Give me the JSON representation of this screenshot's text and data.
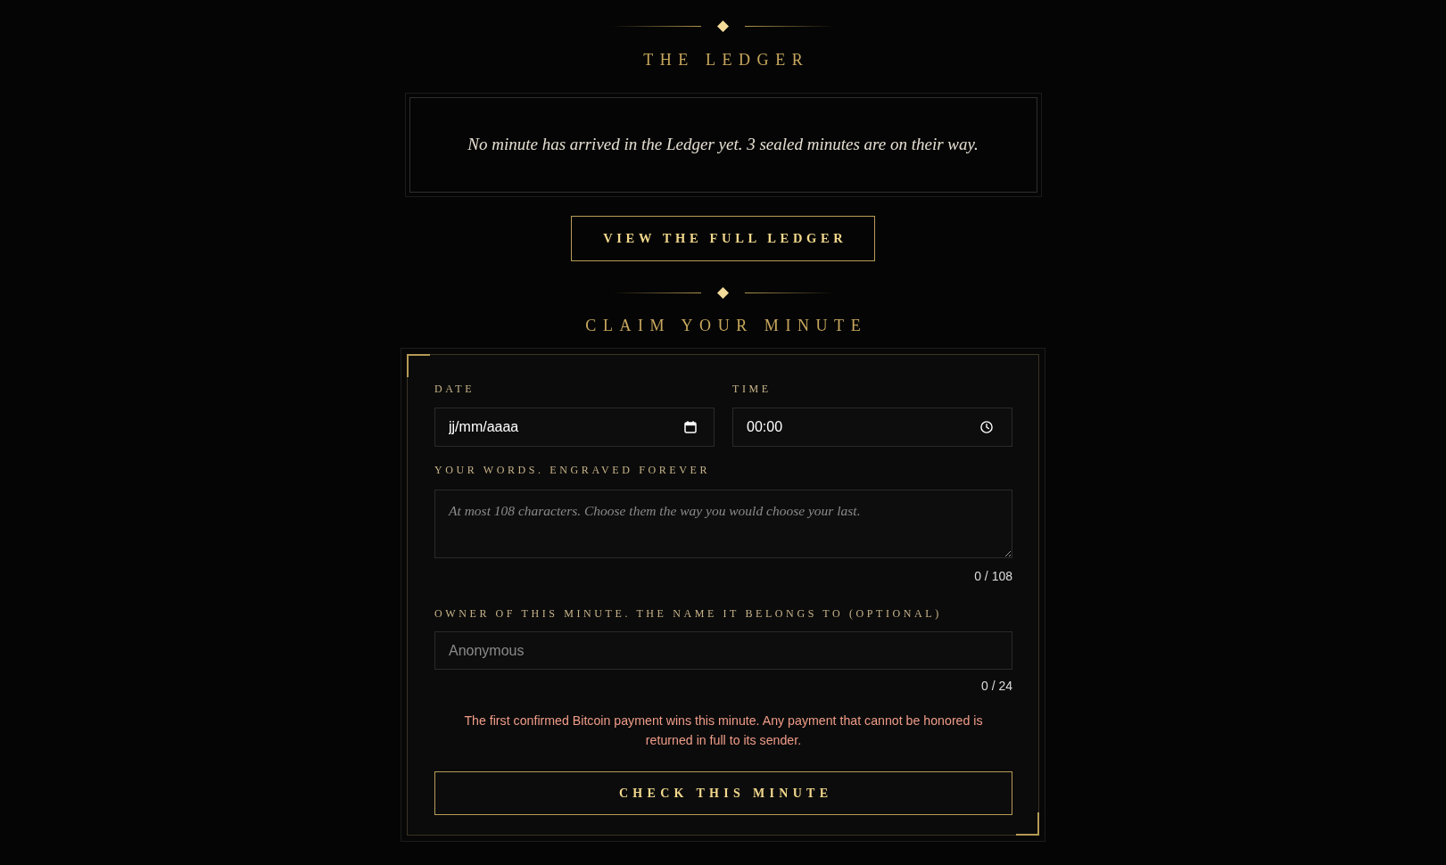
{
  "ledger": {
    "heading": "THE LEDGER",
    "message": "No minute has arrived in the Ledger yet. 3 sealed minutes are on their way.",
    "button": "VIEW THE FULL LEDGER"
  },
  "claim": {
    "heading": "CLAIM YOUR MINUTE",
    "date": {
      "label": "DATE",
      "placeholder": "jj/mm/aaaa"
    },
    "time": {
      "label": "TIME",
      "value": "00:00"
    },
    "words": {
      "label": "YOUR WORDS. ENGRAVED FOREVER",
      "placeholder": "At most 108 characters. Choose them the way you would choose your last.",
      "counter": "0 / 108"
    },
    "owner": {
      "label": "OWNER OF THIS MINUTE. THE NAME IT BELONGS TO (OPTIONAL)",
      "placeholder": "Anonymous",
      "counter": "0 / 24"
    },
    "notice": "The first confirmed Bitcoin payment wins this minute. Any payment that cannot be honored is returned in full to its sender.",
    "button": "CHECK THIS MINUTE"
  }
}
